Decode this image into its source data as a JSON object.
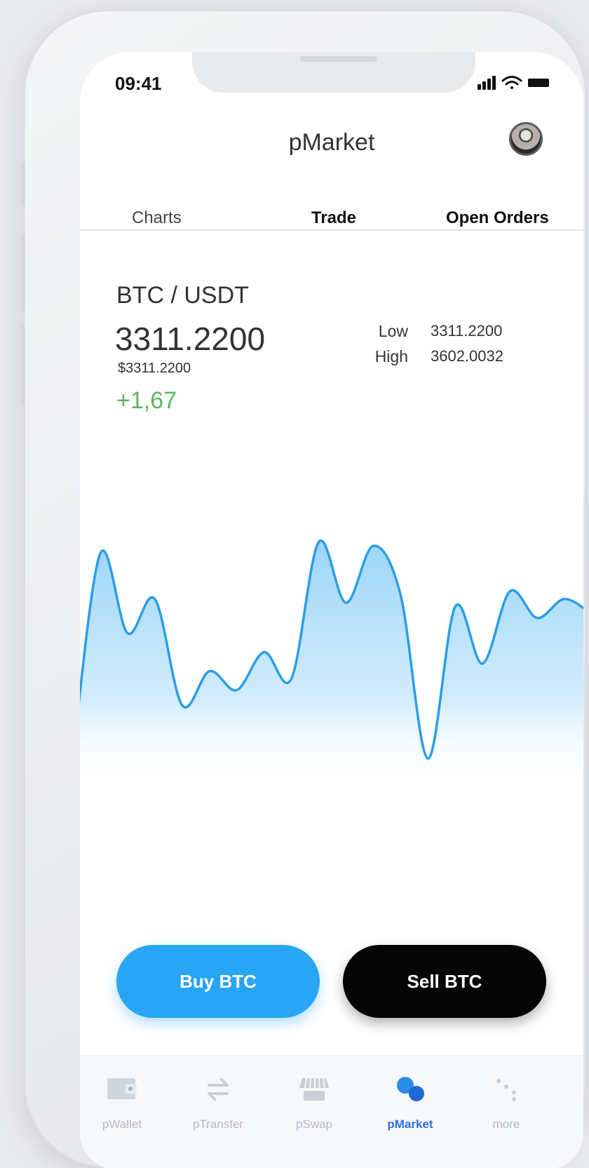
{
  "status_bar": {
    "time": "09:41"
  },
  "header": {
    "title": "pMarket",
    "avatar_icon": "user-avatar"
  },
  "tabs": [
    {
      "label": "Charts",
      "active": false
    },
    {
      "label": "Trade",
      "active": true
    },
    {
      "label": "Open Orders",
      "active": false
    }
  ],
  "market": {
    "pair": "BTC / USDT",
    "price": "3311.2200",
    "fiat_price": "$3311.2200",
    "change": "+1,67",
    "low_label": "Low",
    "low_value": "3311.2200",
    "high_label": "High",
    "high_value": "3602.0032"
  },
  "chart_data": {
    "type": "area",
    "values": [
      2.0,
      7.3,
      5.2,
      6.1,
      3.3,
      4.2,
      3.7,
      4.7,
      4.0,
      7.6,
      6.0,
      7.5,
      6.2,
      1.9,
      5.9,
      4.4,
      6.3,
      5.6,
      6.1,
      5.7
    ],
    "color": "#2a9ee8",
    "title": "",
    "xlabel": "",
    "ylabel": ""
  },
  "actions": {
    "buy_label": "Buy BTC",
    "sell_label": "Sell BTC",
    "buy_color": "#29a5f5",
    "sell_color": "#050505"
  },
  "bottom_nav": [
    {
      "label": "pWallet",
      "icon": "wallet-icon",
      "active": false
    },
    {
      "label": "pTransfer",
      "icon": "transfer-arrows-icon",
      "active": false
    },
    {
      "label": "pSwap",
      "icon": "storefront-icon",
      "active": false
    },
    {
      "label": "pMarket",
      "icon": "market-dots-icon",
      "active": true
    },
    {
      "label": "more",
      "icon": "more-dots-icon",
      "active": false
    }
  ]
}
